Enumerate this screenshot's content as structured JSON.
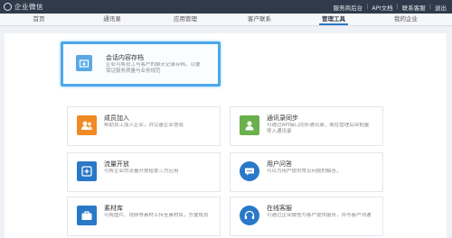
{
  "topbar": {
    "logo_text": "企业微信",
    "links": [
      "服务商后台",
      "API文档",
      "联系客服",
      "退出"
    ]
  },
  "nav": {
    "tabs": [
      "首页",
      "通讯录",
      "应用管理",
      "客户联系",
      "管理工具",
      "我的企业"
    ],
    "active_index": 4
  },
  "featured": {
    "title": "会话内容存档",
    "desc_1": "企业可将员工与客户的聊天记录存档，以便",
    "desc_2": "保证服务质量与业务规范",
    "icon": "archive-icon",
    "icon_color": "#5aa9e6"
  },
  "cards": [
    {
      "title": "成员加入",
      "desc_1": "帮助员工加入企业，并完善企业信息",
      "desc_2": "",
      "icon": "user-add-icon",
      "color": "#f08a24"
    },
    {
      "title": "通讯录同步",
      "desc_1": "可通过API接口同步通讯录，或在管理后台批量",
      "desc_2": "导入通讯录",
      "icon": "contacts-sync-icon",
      "color": "#6ab04c"
    },
    {
      "title": "流量开放",
      "desc_1": "可将企业的流量开放给第三方应用",
      "desc_2": "",
      "icon": "traffic-icon",
      "color": "#2a78c8"
    },
    {
      "title": "用户问答",
      "desc_1": "可以为用户提供常见问题的解答，",
      "desc_2": "",
      "icon": "chat-icon",
      "color": "#2a78c8"
    },
    {
      "title": "素材库",
      "desc_1": "可将图片、视频等素材上传至素材库，方便成员",
      "desc_2": "",
      "icon": "briefcase-icon",
      "color": "#2a78c8"
    },
    {
      "title": "在线客服",
      "desc_1": "可通过企业微信为客户提供服务，并与客户沟通",
      "desc_2": "",
      "icon": "headset-icon",
      "color": "#2a78c8"
    }
  ],
  "colors": {
    "topbar": "#2f3a4a",
    "active_tab_underline": "#2a78c8",
    "featured_border": "#4aa8e8"
  }
}
